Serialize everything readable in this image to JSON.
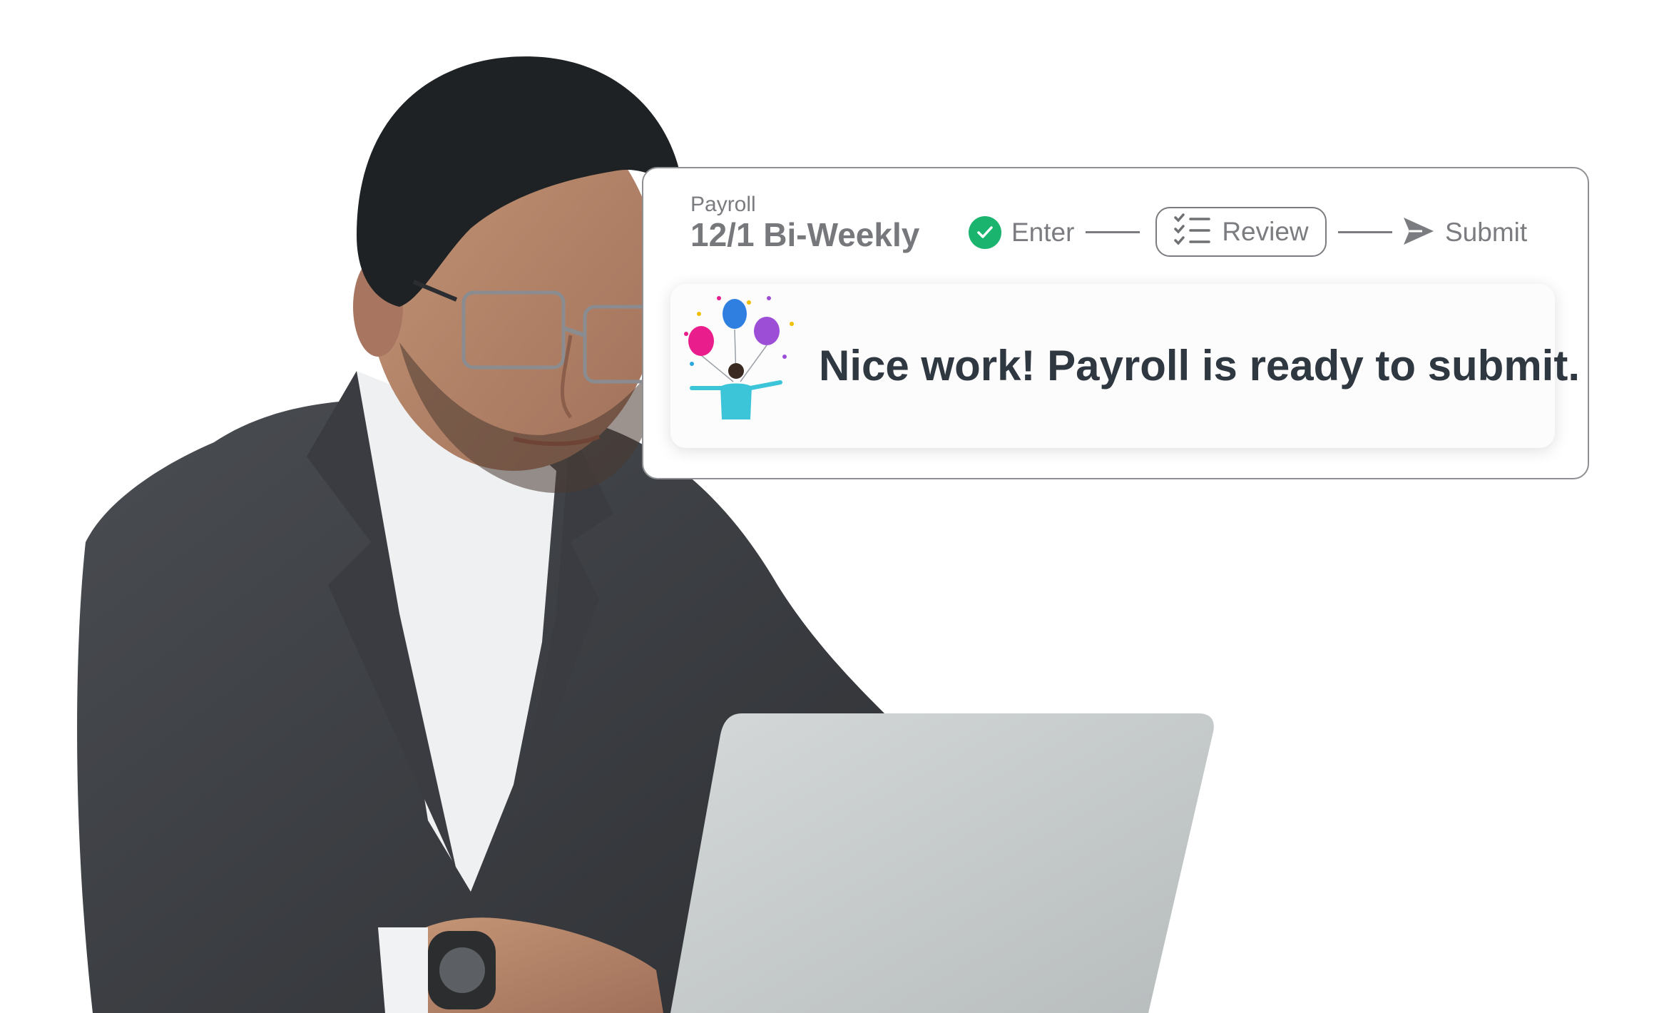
{
  "payroll": {
    "kicker": "Payroll",
    "period": "12/1 Bi-Weekly"
  },
  "stepper": {
    "steps": [
      {
        "label": "Enter",
        "state": "complete",
        "icon": "check-circle-icon"
      },
      {
        "label": "Review",
        "state": "current",
        "icon": "checklist-icon"
      },
      {
        "label": "Submit",
        "state": "upcoming",
        "icon": "send-icon"
      }
    ]
  },
  "notice": {
    "message": "Nice work! Payroll is ready to submit.",
    "illustration": "celebration-balloons-icon"
  },
  "colors": {
    "success": "#1ab46e",
    "text_dark": "#2f3740",
    "text_muted": "#7a7c80",
    "card_border": "#8e9094"
  }
}
